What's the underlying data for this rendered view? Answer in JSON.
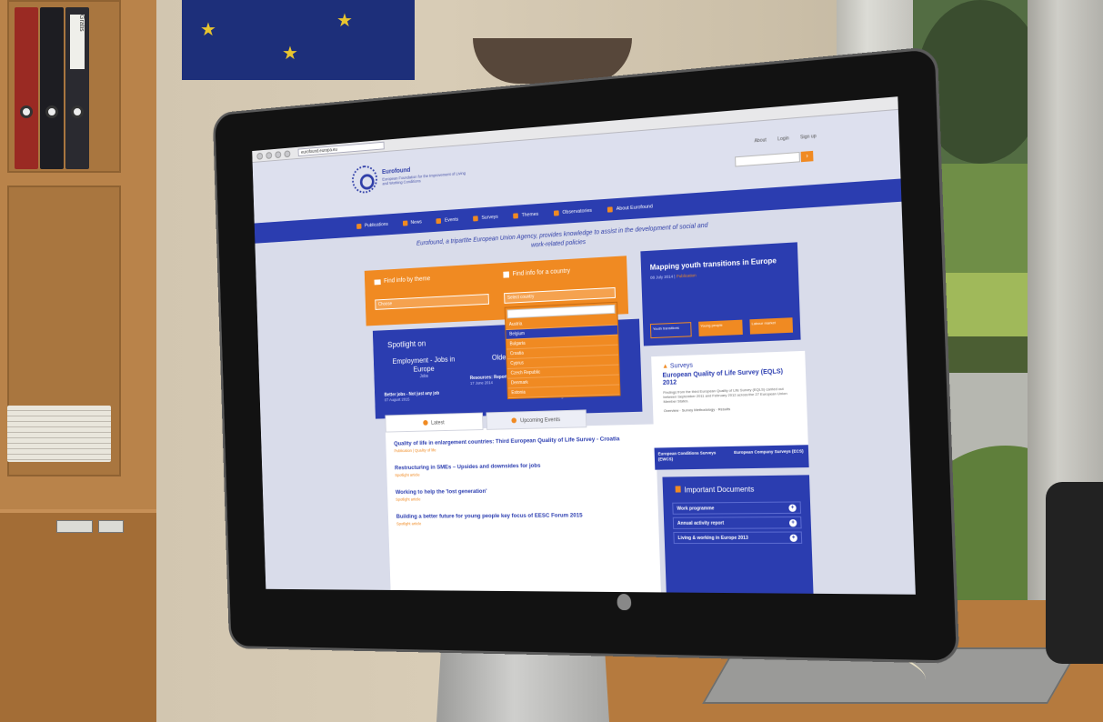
{
  "binders": {
    "label_text": "Gratis"
  },
  "browser": {
    "url": "eurofound.europa.eu"
  },
  "site": {
    "logo_name": "Eurofound",
    "logo_subtitle": "European Foundation for the Improvement of Living and Working Conditions",
    "top_links": [
      "About",
      "Login",
      "Sign up"
    ],
    "search_placeholder": "",
    "search_button": "›",
    "tagline": "Eurofound, a tripartite European Union Agency, provides knowledge to assist in the development of social and work-related policies"
  },
  "nav": {
    "items": [
      "Publications",
      "News",
      "Events",
      "Surveys",
      "Themes",
      "Observatories",
      "About Eurofound"
    ]
  },
  "find": {
    "by_theme_label": "Find info by theme",
    "by_theme_value": "Choose",
    "by_country_label": "Find info for a country",
    "by_country_value": "Select country",
    "country_options": [
      "Austria",
      "Belgium",
      "Bulgaria",
      "Croatia",
      "Cyprus",
      "Czech Republic",
      "Denmark",
      "Estonia"
    ],
    "selected_country": "Belgium"
  },
  "spotlight": {
    "title": "Spotlight on",
    "cards": [
      {
        "heading": "Employment - Jobs in Europe",
        "sub": "Jobs",
        "item": "Better jobs - Not just any job",
        "date": "07 August 2015"
      },
      {
        "heading": "Older people",
        "sub": "",
        "item": "Resources: Reports on older people",
        "date": "17 June 2014"
      },
      {
        "heading": "",
        "sub": "",
        "item": "",
        "date": "14 August 2015"
      }
    ]
  },
  "tabs": {
    "latest": "Latest",
    "upcoming": "Upcoming Events"
  },
  "news": [
    {
      "title": "Quality of life in enlargement countries: Third European Quality of Life Survey - Croatia",
      "category": "Publication | Quality of life"
    },
    {
      "title": "Restructuring in SMEs – Upsides and downsides for jobs",
      "category": "Spotlight article"
    },
    {
      "title": "Working to help the 'lost generation'",
      "category": "Spotlight article"
    },
    {
      "title": "Building a better future for young people key focus of EESC Forum 2015",
      "category": "Spotlight article"
    }
  ],
  "youth": {
    "title": "Mapping youth transitions in Europe",
    "date": "08 July 2014",
    "category": "Publication",
    "buttons": [
      "Youth transitions",
      "Young people",
      "Labour market"
    ]
  },
  "surveys": {
    "label": "Surveys",
    "title": "European Quality of Life Survey (EQLS) 2012",
    "text": "Findings from the third European Quality of Life Survey (EQLS) carried out between September 2011 and February 2012 across the 27 European Union Member States.",
    "links": [
      "Overview",
      "Survey Methodology",
      "Results"
    ],
    "tabs": [
      "European Conditions Surveys (EWCS)",
      "European Company Surveys (ECS)"
    ]
  },
  "docs": {
    "title": "Important Documents",
    "items": [
      "Work programme",
      "Annual activity report",
      "Living & working in Europe 2013"
    ]
  }
}
